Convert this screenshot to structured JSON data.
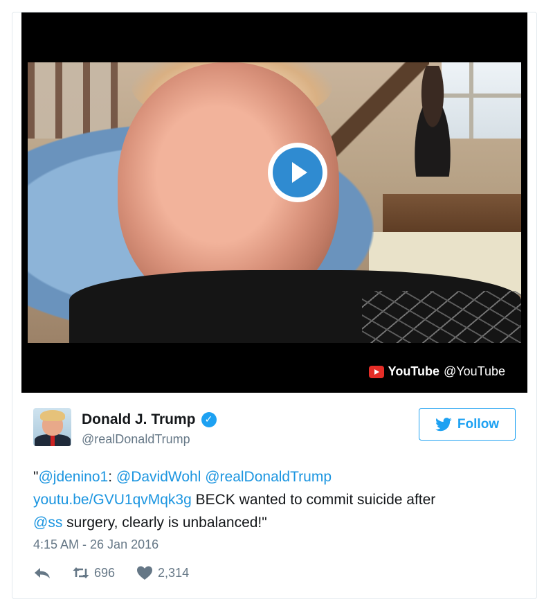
{
  "media": {
    "provider_brand": "YouTube",
    "provider_handle": "@YouTube",
    "play_icon": "play-icon"
  },
  "author": {
    "name": "Donald J. Trump",
    "handle": "@realDonaldTrump",
    "verified_icon": "verified-badge-icon"
  },
  "follow_button": {
    "label": "Follow",
    "icon": "twitter-bird-icon"
  },
  "tweet": {
    "open_quote": "\"",
    "mention_1": "@jdenino1",
    "colon": ":",
    "mention_2": "@DavidWohl",
    "mention_3": "@realDonaldTrump",
    "link": "youtu.be/GVU1qvMqk3g",
    "text_1": "BECK wanted to commit suicide after",
    "mention_4": "@ss",
    "text_2": "surgery, clearly is unbalanced!\""
  },
  "timestamp": "4:15 AM - 26 Jan 2016",
  "actions": {
    "reply_icon": "reply-icon",
    "retweet_icon": "retweet-icon",
    "retweet_count": "696",
    "like_icon": "heart-icon",
    "like_count": "2,314"
  },
  "colors": {
    "link": "#1b95e0",
    "accent": "#1da1f2",
    "youtube_red": "#e52d27",
    "muted": "#657786"
  }
}
